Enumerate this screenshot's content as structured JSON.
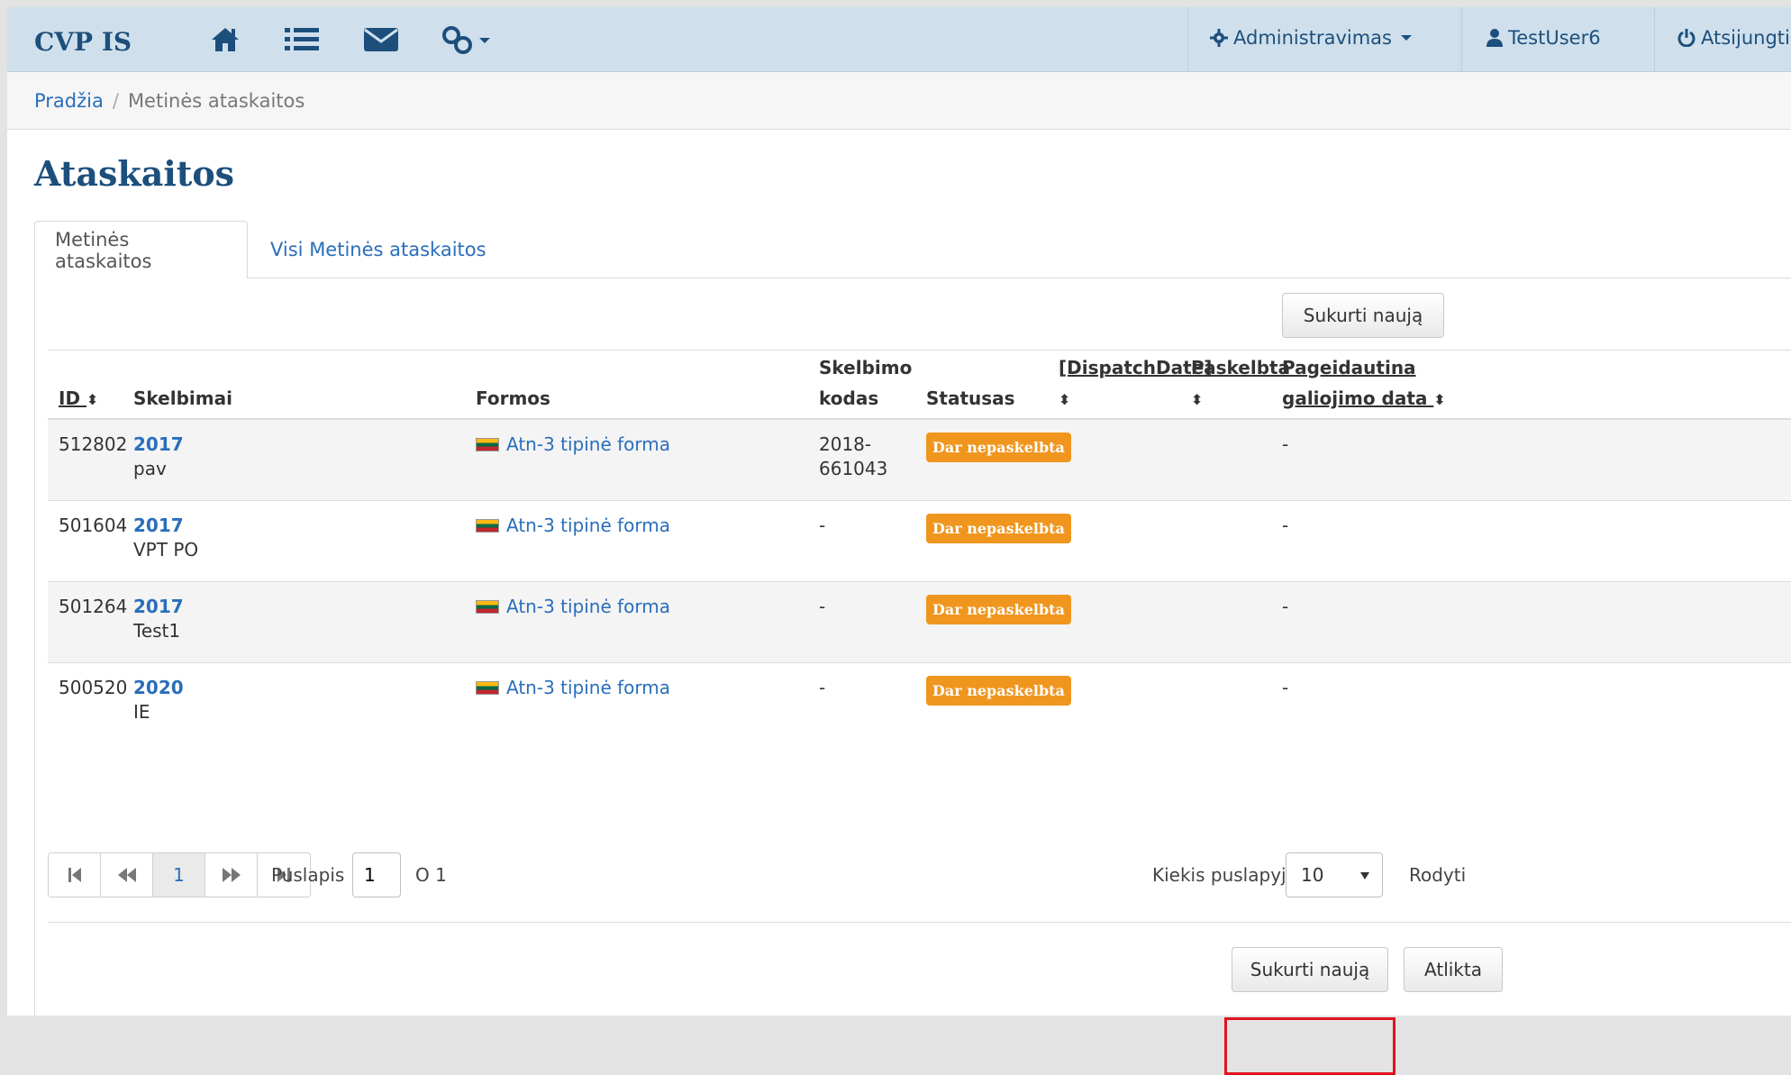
{
  "navbar": {
    "brand": "CVP IS",
    "icons": [
      "home-icon",
      "list-icon",
      "envelope-icon",
      "link-icon"
    ],
    "admin_label": "Administravimas",
    "user_label": "TestUser6",
    "logout_label": "Atsijungti"
  },
  "breadcrumb": {
    "home": "Pradžia",
    "current": "Metinės ataskaitos"
  },
  "page": {
    "title": "Ataskaitos"
  },
  "tabs": [
    {
      "label": "Metinės ataskaitos",
      "active": true
    },
    {
      "label": "Visi Metinės ataskaitos",
      "active": false
    }
  ],
  "toolbar": {
    "create_label": "Sukurti naują"
  },
  "table": {
    "headers": {
      "id": "ID",
      "skelbimai": "Skelbimai",
      "formos": "Formos",
      "skelbimo_kodas_1": "Skelbimo",
      "skelbimo_kodas_2": "kodas",
      "statusas": "Statusas",
      "dispatch": "[DispatchDate]",
      "paskelbta": "Paskelbta",
      "pageidautina_1": "Pageidautina",
      "pageidautina_2": "galiojimo data"
    },
    "rows": [
      {
        "id": "512802",
        "year": "2017",
        "name": "pav",
        "form": "Atn-3 tipinė forma",
        "code_1": "2018-",
        "code_2": "661043",
        "status": "Dar nepaskelbta",
        "date": "-"
      },
      {
        "id": "501604",
        "year": "2017",
        "name": "VPT PO",
        "form": "Atn-3 tipinė forma",
        "code_1": "-",
        "code_2": "",
        "status": "Dar nepaskelbta",
        "date": "-"
      },
      {
        "id": "501264",
        "year": "2017",
        "name": "Test1",
        "form": "Atn-3 tipinė forma",
        "code_1": "-",
        "code_2": "",
        "status": "Dar nepaskelbta",
        "date": "-"
      },
      {
        "id": "500520",
        "year": "2020",
        "name": "IE",
        "form": "Atn-3 tipinė forma",
        "code_1": "-",
        "code_2": "",
        "status": "Dar nepaskelbta",
        "date": "-"
      }
    ]
  },
  "pagination": {
    "current_page": "1",
    "page_label": "Puslapis",
    "page_input": "1",
    "of_label": "O 1",
    "per_page_label": "Kiekis puslapyje",
    "per_page_value": "10",
    "show_label": "Rodyti"
  },
  "footer": {
    "create_label": "Sukurti naują",
    "done_label": "Atlikta"
  },
  "colors": {
    "navbar_bg": "#cfe0ec",
    "brand": "#1d4f7c",
    "link": "#2a6ebb",
    "badge": "#f0961e",
    "highlight": "#e0141e"
  }
}
